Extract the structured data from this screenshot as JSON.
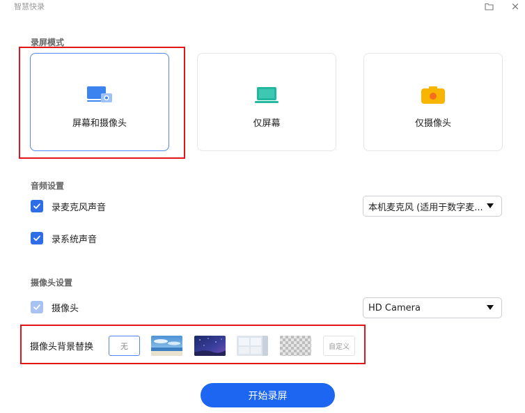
{
  "app": {
    "title": "智慧快录",
    "close_glyph": "×"
  },
  "record_mode": {
    "heading": "录屏模式",
    "modes": [
      {
        "label": "屏幕和摄像头",
        "icon": "screen-camera-icon",
        "selected": true
      },
      {
        "label": "仅屏幕",
        "icon": "laptop-icon",
        "selected": false
      },
      {
        "label": "仅摄像头",
        "icon": "camera-icon",
        "selected": false
      }
    ]
  },
  "audio": {
    "heading": "音频设置",
    "mic": {
      "label": "录麦克风声音",
      "checked": true
    },
    "system": {
      "label": "录系统声音",
      "checked": true
    },
    "mic_device": "本机麦克风 (适用于数字麦..."
  },
  "camera": {
    "heading": "摄像头设置",
    "camera_toggle": {
      "label": "摄像头",
      "checked": true
    },
    "device": "HD Camera",
    "background": {
      "label": "摄像头背景替换",
      "none_label": "无",
      "custom_label": "自定义",
      "thumbnails": [
        "beach-background",
        "night-sky-background",
        "room-background",
        "transparent-background"
      ]
    }
  },
  "actions": {
    "start_label": "开始录屏"
  },
  "colors": {
    "accent": "#1d66f2",
    "highlight": "#e01616",
    "selected_border": "#4d86f5"
  }
}
